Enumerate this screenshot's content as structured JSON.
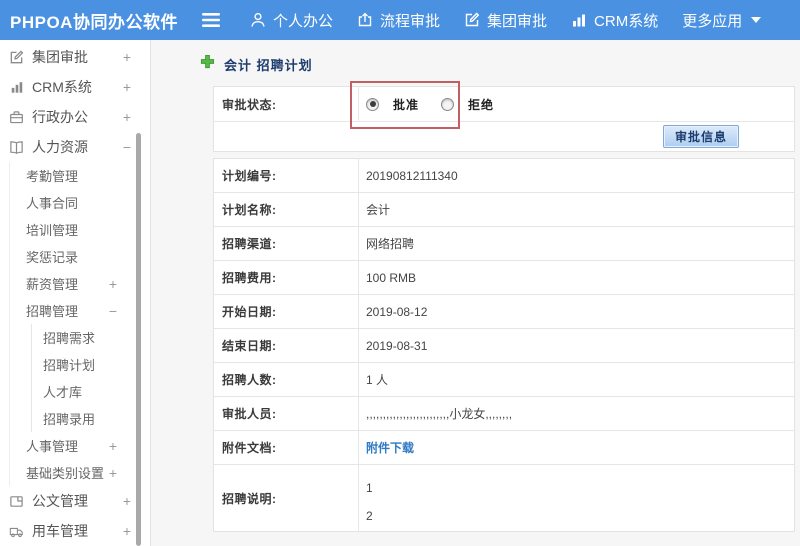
{
  "topbar": {
    "brand": "PHPOA协同办公软件",
    "menu": [
      {
        "label": "个人办公",
        "icon": "user-icon"
      },
      {
        "label": "流程审批",
        "icon": "export-icon"
      },
      {
        "label": "集团审批",
        "icon": "edit-icon"
      },
      {
        "label": "CRM系统",
        "icon": "bar-chart-icon"
      },
      {
        "label": "更多应用",
        "icon": "caret-down-icon"
      }
    ]
  },
  "sidebar": {
    "items": [
      {
        "label": "集团审批",
        "expander": "+",
        "icon": "edit-icon"
      },
      {
        "label": "CRM系统",
        "expander": "+",
        "icon": "bar-chart-icon"
      },
      {
        "label": "行政办公",
        "expander": "+",
        "icon": "briefcase-icon"
      },
      {
        "label": "人力资源",
        "expander": "−",
        "icon": "book-icon"
      },
      {
        "label": "考勤管理"
      },
      {
        "label": "人事合同"
      },
      {
        "label": "培训管理"
      },
      {
        "label": "奖惩记录"
      },
      {
        "label": "薪资管理",
        "expander": "+"
      },
      {
        "label": "招聘管理",
        "expander": "−"
      },
      {
        "label": "招聘需求"
      },
      {
        "label": "招聘计划"
      },
      {
        "label": "人才库"
      },
      {
        "label": "招聘录用"
      },
      {
        "label": "人事管理",
        "expander": "+"
      },
      {
        "label": "基础类别设置",
        "expander": "+"
      },
      {
        "label": "公文管理",
        "expander": "+",
        "icon": "document-icon"
      },
      {
        "label": "用车管理",
        "expander": "+",
        "icon": "truck-icon"
      }
    ]
  },
  "main": {
    "title": "会计 招聘计划",
    "approval": {
      "label": "审批状态:",
      "approve_label": "批准",
      "reject_label": "拒绝",
      "approve_selected": true,
      "button_label": "审批信息"
    },
    "fields": [
      {
        "label": "计划编号:",
        "value": "20190812111340"
      },
      {
        "label": "计划名称:",
        "value": "会计"
      },
      {
        "label": "招聘渠道:",
        "value": "网络招聘"
      },
      {
        "label": "招聘费用:",
        "value": "100 RMB"
      },
      {
        "label": "开始日期:",
        "value": "2019-08-12"
      },
      {
        "label": "结束日期:",
        "value": "2019-08-31"
      },
      {
        "label": "招聘人数:",
        "value": "1 人"
      },
      {
        "label": "审批人员:",
        "value": ",,,,,,,,,,,,,,,,,,,,,,,,,小龙女,,,,,,,,"
      },
      {
        "label": "附件文档:",
        "value": "附件下载"
      },
      {
        "label": "招聘说明:",
        "line1": "1",
        "line2": "2"
      }
    ]
  },
  "colors": {
    "topbar_blue": "#4a91e2",
    "title_navy": "#1c3d6e",
    "link_blue": "#2f79c5",
    "annotation_red": "#c25f63",
    "button_blue": "#aecdf0"
  }
}
